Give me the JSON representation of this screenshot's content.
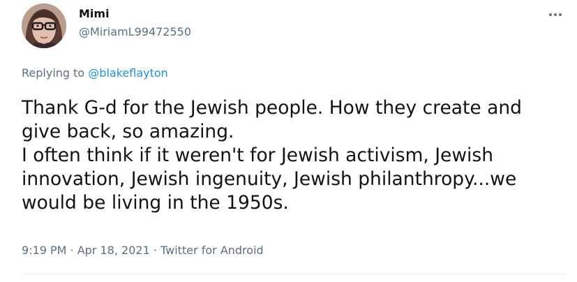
{
  "user": {
    "display_name": "Mimi",
    "handle": "@MiriamL99472550"
  },
  "reply": {
    "prefix": "Replying to ",
    "mention": "@blakeflayton"
  },
  "tweet": {
    "lines": [
      "Thank G-d for the Jewish people. How they create and",
      "give back, so amazing.",
      "I often think if it weren't for Jewish activism, Jewish",
      "innovation, Jewish ingenuity, Jewish philanthropy...we",
      "would be living in the 1950s."
    ]
  },
  "meta": {
    "time": "9:19 PM",
    "sep1": " · ",
    "date": "Apr 18, 2021",
    "sep2": " · ",
    "source": "Twitter for Android"
  },
  "icons": {
    "more": "more-horizontal-icon",
    "avatar": "profile-photo"
  },
  "colors": {
    "text": "#0f1419",
    "secondary": "#5b7083",
    "link": "#1b95e0",
    "divider": "#e6ecf0"
  }
}
